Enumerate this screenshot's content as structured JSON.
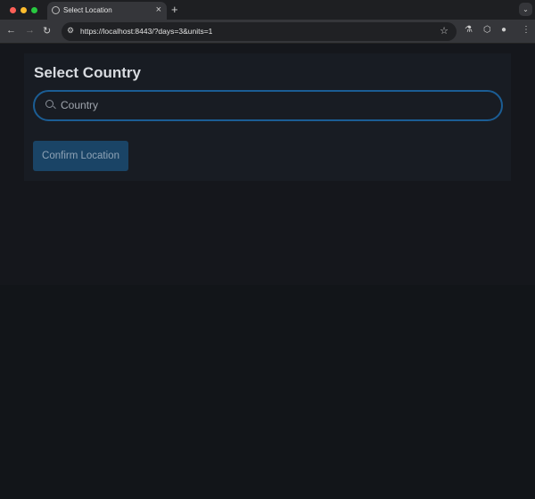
{
  "browser": {
    "tab_title": "Select Location",
    "url": "https://localhost:8443/?days=3&units=1"
  },
  "page": {
    "title": "Select Country",
    "search_placeholder": "Country",
    "search_value": "",
    "confirm_label": "Confirm Location"
  },
  "colors": {
    "accent": "#1b5d94",
    "button": "#1a4466"
  }
}
